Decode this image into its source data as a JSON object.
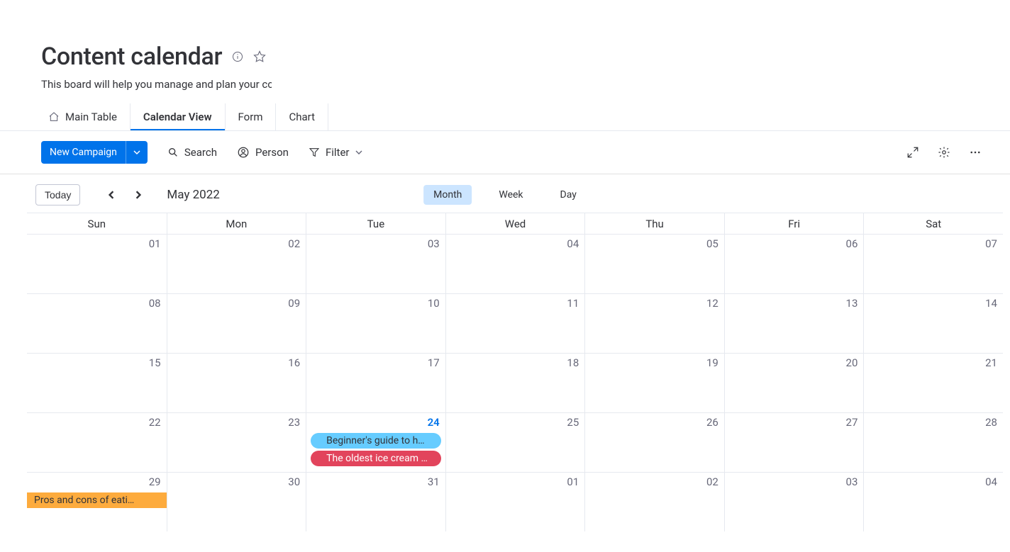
{
  "header": {
    "title": "Content calendar",
    "subtitle": "This board will help you manage and plan your content"
  },
  "tabs": {
    "main_table": "Main Table",
    "calendar_view": "Calendar View",
    "form": "Form",
    "chart": "Chart"
  },
  "toolbar": {
    "new_campaign": "New Campaign",
    "search": "Search",
    "person": "Person",
    "filter": "Filter"
  },
  "calendar_nav": {
    "today": "Today",
    "month_label": "May 2022",
    "view_month": "Month",
    "view_week": "Week",
    "view_day": "Day"
  },
  "dow": [
    "Sun",
    "Mon",
    "Tue",
    "Wed",
    "Thu",
    "Fri",
    "Sat"
  ],
  "weeks": [
    [
      {
        "num": "01"
      },
      {
        "num": "02"
      },
      {
        "num": "03"
      },
      {
        "num": "04"
      },
      {
        "num": "05"
      },
      {
        "num": "06"
      },
      {
        "num": "07"
      }
    ],
    [
      {
        "num": "08"
      },
      {
        "num": "09"
      },
      {
        "num": "10"
      },
      {
        "num": "11"
      },
      {
        "num": "12"
      },
      {
        "num": "13"
      },
      {
        "num": "14"
      }
    ],
    [
      {
        "num": "15"
      },
      {
        "num": "16"
      },
      {
        "num": "17"
      },
      {
        "num": "18"
      },
      {
        "num": "19"
      },
      {
        "num": "20"
      },
      {
        "num": "21"
      }
    ],
    [
      {
        "num": "22"
      },
      {
        "num": "23"
      },
      {
        "num": "24",
        "highlight": true,
        "events": [
          {
            "label": "Beginner's guide to h…",
            "color": "blue"
          },
          {
            "label": "The oldest ice cream …",
            "color": "pink"
          }
        ]
      },
      {
        "num": "25"
      },
      {
        "num": "26"
      },
      {
        "num": "27"
      },
      {
        "num": "28"
      }
    ],
    [
      {
        "num": "29",
        "events": [
          {
            "label": "Pros and cons of eati…",
            "color": "orange",
            "full": true
          }
        ]
      },
      {
        "num": "30"
      },
      {
        "num": "31"
      },
      {
        "num": "01"
      },
      {
        "num": "02"
      },
      {
        "num": "03"
      },
      {
        "num": "04"
      }
    ]
  ]
}
